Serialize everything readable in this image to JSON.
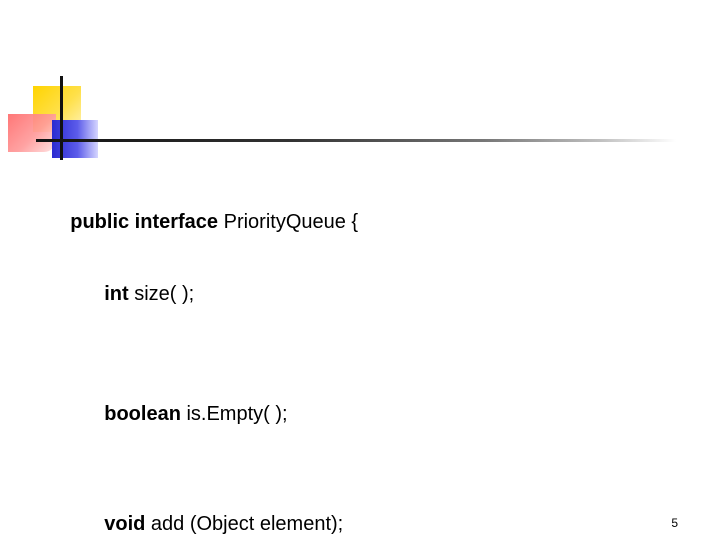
{
  "code": {
    "line1": {
      "keyword": "public interface",
      "rest": " PriorityQueue {"
    },
    "line2": {
      "keyword": "int",
      "rest": " size( );"
    },
    "line3": {
      "keyword": "boolean",
      "rest": " is.Empty( );"
    },
    "line4": {
      "keyword": "void",
      "rest": " add (Object element);"
    }
  },
  "page_number": "5",
  "colors": {
    "yellow": "#ffd400",
    "red": "#ff6b6b",
    "blue": "#2b2bd1",
    "line": "#111111"
  },
  "icons": {
    "logo": "slide-logo-icon"
  }
}
